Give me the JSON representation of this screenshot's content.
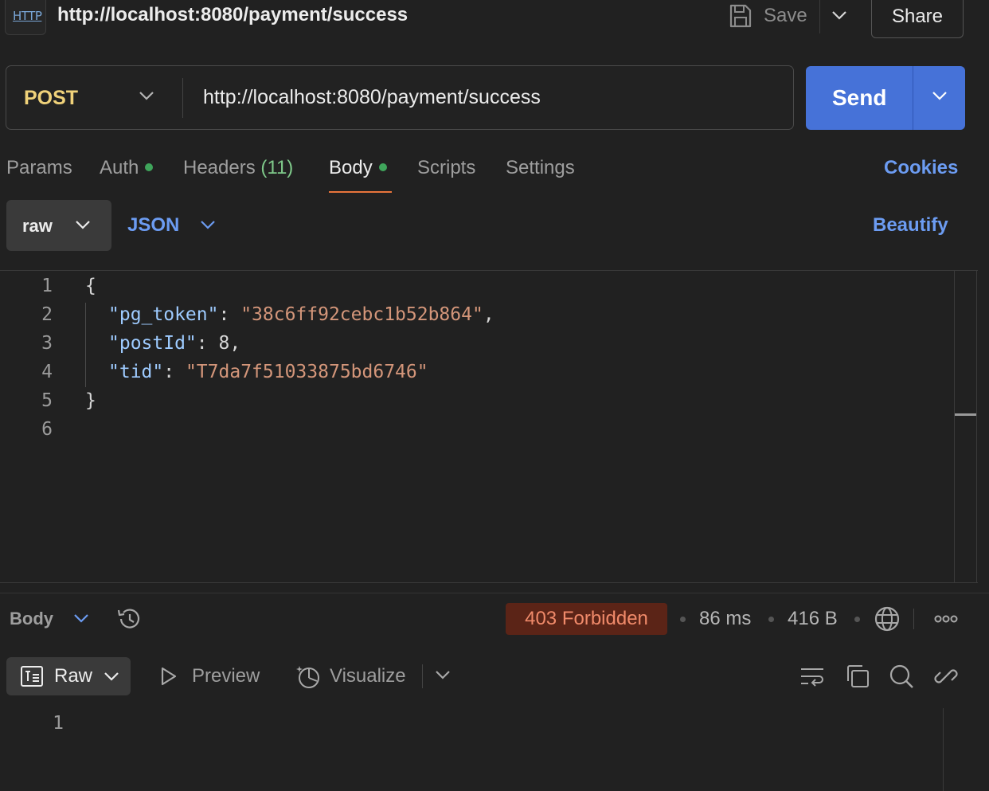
{
  "header": {
    "badge": "HTTP",
    "title": "http://localhost:8080/payment/success",
    "save_label": "Save",
    "share_label": "Share"
  },
  "request": {
    "method": "POST",
    "url": "http://localhost:8080/payment/success",
    "send_label": "Send"
  },
  "tabs": {
    "params": "Params",
    "auth": "Auth",
    "headers": "Headers",
    "headers_count": "(11)",
    "body": "Body",
    "scripts": "Scripts",
    "settings": "Settings",
    "cookies": "Cookies"
  },
  "body_options": {
    "mode": "raw",
    "format": "JSON",
    "beautify": "Beautify"
  },
  "editor": {
    "line_numbers": [
      "1",
      "2",
      "3",
      "4",
      "5",
      "6"
    ],
    "open_brace": "{",
    "close_brace": "}",
    "fields": [
      {
        "key": "\"pg_token\"",
        "value": "\"38c6ff92cebc1b52b864\"",
        "trail": ","
      },
      {
        "key": "\"postId\"",
        "value": "8",
        "trail": ","
      },
      {
        "key": "\"tid\"",
        "value": "\"T7da7f51033875bd6746\"",
        "trail": ""
      }
    ]
  },
  "response": {
    "section_label": "Body",
    "status": "403 Forbidden",
    "time": "86 ms",
    "size": "416 B",
    "view_mode": "Raw",
    "preview_label": "Preview",
    "visualize_label": "Visualize",
    "line_numbers": [
      "1"
    ]
  },
  "colors": {
    "accent_blue": "#4672d8",
    "link_blue": "#6c9cf2",
    "active_tab_underline": "#e8743b",
    "status_bg": "#5b2417",
    "status_text": "#f08a6a",
    "method_color": "#f0d27a",
    "indicator_green": "#3fa55b"
  },
  "icons": [
    "save-icon",
    "chevron-down-icon",
    "history-icon",
    "globe-icon",
    "more-icon",
    "raw-doc-icon",
    "play-icon",
    "visualize-icon",
    "wrap-icon",
    "copy-icon",
    "search-icon",
    "link-icon"
  ]
}
